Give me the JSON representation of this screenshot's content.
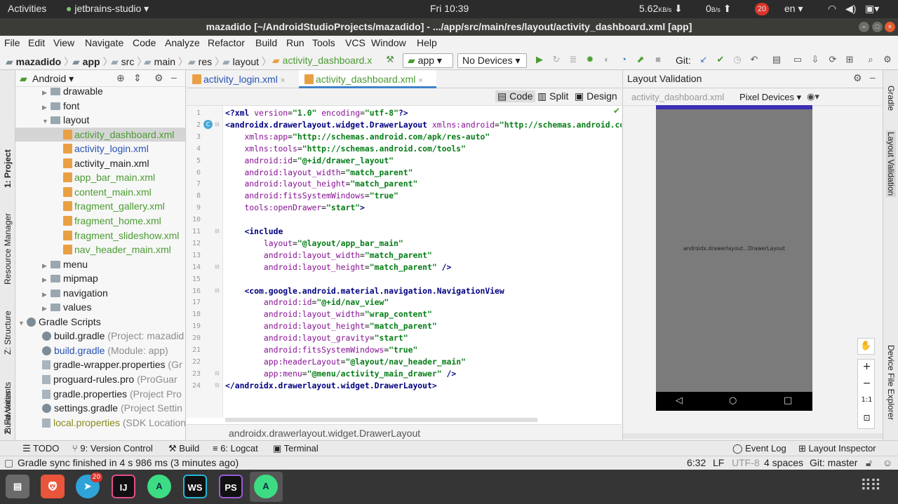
{
  "topbar": {
    "activities": "Activities",
    "app_menu": "jetbrains-studio ▾",
    "clock": "Fri 10:39",
    "net_down": "5.62",
    "net_down_unit": "KB/s",
    "net_up": "0",
    "net_up_unit": "B/s",
    "badge": "20",
    "lang": "en ▾"
  },
  "window": {
    "title": "mazadido [~/AndroidStudioProjects/mazadido] - .../app/src/main/res/layout/activity_dashboard.xml [app]"
  },
  "menu": [
    "File",
    "Edit",
    "View",
    "Navigate",
    "Code",
    "Analyze",
    "Refactor",
    "Build",
    "Run",
    "Tools",
    "VCS",
    "Window",
    "Help"
  ],
  "breadcrumbs": [
    "mazadido",
    "app",
    "src",
    "main",
    "res",
    "layout",
    "activity_dashboard.x"
  ],
  "toolbar": {
    "config": "app",
    "devices": "No Devices",
    "git_label": "Git:"
  },
  "side_left": [
    "1: Project",
    "Resource Manager",
    "Z: Structure",
    "Build Variants",
    "2: Favorites"
  ],
  "side_right": [
    "Gradle",
    "Layout Validation",
    "Device File Explorer"
  ],
  "project": {
    "view": "Android",
    "tree": [
      {
        "label": "drawable",
        "kind": "folder",
        "indent": 1
      },
      {
        "label": "font",
        "kind": "folder",
        "indent": 1
      },
      {
        "label": "layout",
        "kind": "folder-open",
        "indent": 1
      },
      {
        "label": "activity_dashboard.xml",
        "kind": "xml",
        "indent": 2,
        "color": "green",
        "selected": true
      },
      {
        "label": "activity_login.xml",
        "kind": "xml",
        "indent": 2,
        "color": "blue"
      },
      {
        "label": "activity_main.xml",
        "kind": "xml",
        "indent": 2,
        "color": "normal"
      },
      {
        "label": "app_bar_main.xml",
        "kind": "xml",
        "indent": 2,
        "color": "green"
      },
      {
        "label": "content_main.xml",
        "kind": "xml",
        "indent": 2,
        "color": "green"
      },
      {
        "label": "fragment_gallery.xml",
        "kind": "xml",
        "indent": 2,
        "color": "green"
      },
      {
        "label": "fragment_home.xml",
        "kind": "xml",
        "indent": 2,
        "color": "green"
      },
      {
        "label": "fragment_slideshow.xml",
        "kind": "xml",
        "indent": 2,
        "color": "green"
      },
      {
        "label": "nav_header_main.xml",
        "kind": "xml",
        "indent": 2,
        "color": "green"
      },
      {
        "label": "menu",
        "kind": "folder",
        "indent": 1
      },
      {
        "label": "mipmap",
        "kind": "folder",
        "indent": 1
      },
      {
        "label": "navigation",
        "kind": "folder",
        "indent": 1
      },
      {
        "label": "values",
        "kind": "folder",
        "indent": 1
      },
      {
        "label": "Gradle Scripts",
        "kind": "gradle-root",
        "indent": 0
      },
      {
        "label": "build.gradle",
        "hint": "(Project: mazadid",
        "kind": "gradle",
        "indent": 1,
        "color": "normal"
      },
      {
        "label": "build.gradle",
        "hint": "(Module: app)",
        "kind": "gradle",
        "indent": 1,
        "color": "blue"
      },
      {
        "label": "gradle-wrapper.properties",
        "hint": "(Gr",
        "kind": "prop",
        "indent": 1,
        "color": "normal"
      },
      {
        "label": "proguard-rules.pro",
        "hint": "(ProGuar",
        "kind": "prop",
        "indent": 1,
        "color": "normal"
      },
      {
        "label": "gradle.properties",
        "hint": "(Project Pro",
        "kind": "prop",
        "indent": 1,
        "color": "normal"
      },
      {
        "label": "settings.gradle",
        "hint": "(Project Settin",
        "kind": "gradle",
        "indent": 1,
        "color": "normal"
      },
      {
        "label": "local.properties",
        "hint": "(SDK Location",
        "kind": "prop",
        "indent": 1,
        "color": "olive"
      }
    ]
  },
  "editor": {
    "tabs": [
      "activity_login.xml",
      "activity_dashboard.xml"
    ],
    "views": [
      "Code",
      "Split",
      "Design"
    ],
    "lines": [
      [
        [
          "tag",
          "<?xml "
        ],
        [
          "ns",
          "version"
        ],
        [
          "p",
          "="
        ],
        [
          "val",
          "\"1.0\""
        ],
        [
          "p",
          " "
        ],
        [
          "ns",
          "encoding"
        ],
        [
          "p",
          "="
        ],
        [
          "val",
          "\"utf-8\""
        ],
        [
          "tag",
          "?>"
        ]
      ],
      [
        [
          "tag",
          "<androidx.drawerlayout.widget.DrawerLayout "
        ],
        [
          "ns",
          "xmlns:android"
        ],
        [
          "p",
          "="
        ],
        [
          "val",
          "\"http://schemas.android.com/a"
        ]
      ],
      [
        [
          "p",
          "    "
        ],
        [
          "ns",
          "xmlns:app"
        ],
        [
          "p",
          "="
        ],
        [
          "val",
          "\"http://schemas.android.com/apk/res-auto\""
        ]
      ],
      [
        [
          "p",
          "    "
        ],
        [
          "ns",
          "xmlns:tools"
        ],
        [
          "p",
          "="
        ],
        [
          "val",
          "\"http://schemas.android.com/tools\""
        ]
      ],
      [
        [
          "p",
          "    "
        ],
        [
          "ns",
          "android:id"
        ],
        [
          "p",
          "="
        ],
        [
          "val",
          "\"@+id/drawer_layout\""
        ]
      ],
      [
        [
          "p",
          "    "
        ],
        [
          "ns",
          "android:layout_width"
        ],
        [
          "p",
          "="
        ],
        [
          "val",
          "\"match_parent\""
        ]
      ],
      [
        [
          "p",
          "    "
        ],
        [
          "ns",
          "android:layout_height"
        ],
        [
          "p",
          "="
        ],
        [
          "val",
          "\"match_parent\""
        ]
      ],
      [
        [
          "p",
          "    "
        ],
        [
          "ns",
          "android:fitsSystemWindows"
        ],
        [
          "p",
          "="
        ],
        [
          "val",
          "\"true\""
        ]
      ],
      [
        [
          "p",
          "    "
        ],
        [
          "ns",
          "tools:openDrawer"
        ],
        [
          "p",
          "="
        ],
        [
          "val",
          "\"start\""
        ],
        [
          "tag",
          ">"
        ]
      ],
      [
        [
          "p",
          ""
        ]
      ],
      [
        [
          "p",
          "    "
        ],
        [
          "tag",
          "<include"
        ]
      ],
      [
        [
          "p",
          "        "
        ],
        [
          "ns",
          "layout"
        ],
        [
          "p",
          "="
        ],
        [
          "val",
          "\"@layout/app_bar_main\""
        ]
      ],
      [
        [
          "p",
          "        "
        ],
        [
          "ns",
          "android:layout_width"
        ],
        [
          "p",
          "="
        ],
        [
          "val",
          "\"match_parent\""
        ]
      ],
      [
        [
          "p",
          "        "
        ],
        [
          "ns",
          "android:layout_height"
        ],
        [
          "p",
          "="
        ],
        [
          "val",
          "\"match_parent\""
        ],
        [
          "p",
          " "
        ],
        [
          "tag",
          "/>"
        ]
      ],
      [
        [
          "p",
          ""
        ]
      ],
      [
        [
          "p",
          "    "
        ],
        [
          "tag",
          "<com.google.android.material.navigation.NavigationView"
        ]
      ],
      [
        [
          "p",
          "        "
        ],
        [
          "ns",
          "android:id"
        ],
        [
          "p",
          "="
        ],
        [
          "val",
          "\"@+id/nav_view\""
        ]
      ],
      [
        [
          "p",
          "        "
        ],
        [
          "ns",
          "android:layout_width"
        ],
        [
          "p",
          "="
        ],
        [
          "val",
          "\"wrap_content\""
        ]
      ],
      [
        [
          "p",
          "        "
        ],
        [
          "ns",
          "android:layout_height"
        ],
        [
          "p",
          "="
        ],
        [
          "val",
          "\"match_parent\""
        ]
      ],
      [
        [
          "p",
          "        "
        ],
        [
          "ns",
          "android:layout_gravity"
        ],
        [
          "p",
          "="
        ],
        [
          "val",
          "\"start\""
        ]
      ],
      [
        [
          "p",
          "        "
        ],
        [
          "ns",
          "android:fitsSystemWindows"
        ],
        [
          "p",
          "="
        ],
        [
          "val",
          "\"true\""
        ]
      ],
      [
        [
          "p",
          "        "
        ],
        [
          "ns",
          "app:headerLayout"
        ],
        [
          "p",
          "="
        ],
        [
          "val",
          "\"@layout/nav_header_main\""
        ]
      ],
      [
        [
          "p",
          "        "
        ],
        [
          "ns",
          "app:menu"
        ],
        [
          "p",
          "="
        ],
        [
          "val",
          "\"@menu/activity_main_drawer\""
        ],
        [
          "p",
          " "
        ],
        [
          "tag",
          "/>"
        ]
      ],
      [
        [
          "tag",
          "</androidx.drawerlayout.widget.DrawerLayout>"
        ]
      ]
    ],
    "breadcrumb": "androidx.drawerlayout.widget.DrawerLayout"
  },
  "validation": {
    "title": "Layout Validation",
    "file": "activity_dashboard.xml",
    "devices": "Pixel Devices",
    "preview_label": "androidx.drawerlayout...DrawerLayout",
    "zoom_fit": "1:1"
  },
  "bottom_tools": {
    "todo": "TODO",
    "vc": "9: Version Control",
    "build": "Build",
    "logcat": "6: Logcat",
    "terminal": "Terminal",
    "event_log": "Event Log",
    "layout_inspector": "Layout Inspector"
  },
  "status": {
    "message": "Gradle sync finished in 4 s 986 ms (3 minutes ago)",
    "position": "6:32",
    "line_sep": "LF",
    "encoding": "UTF-8",
    "indent": "4 spaces",
    "branch": "Git: master"
  },
  "dock": {
    "items": [
      "files",
      "brave",
      "telegram",
      "intellij",
      "android-studio",
      "webstorm",
      "phpstorm",
      "android-studio-active"
    ],
    "telegram_badge": "20",
    "ij_label": "IJ",
    "ws_label": "WS",
    "ps_label": "PS"
  },
  "colors": {
    "accent": "#4083c9",
    "code_tag": "#000080",
    "code_attr": "#871094",
    "code_value": "#067d17",
    "phone_status": "#3d2fb3"
  }
}
